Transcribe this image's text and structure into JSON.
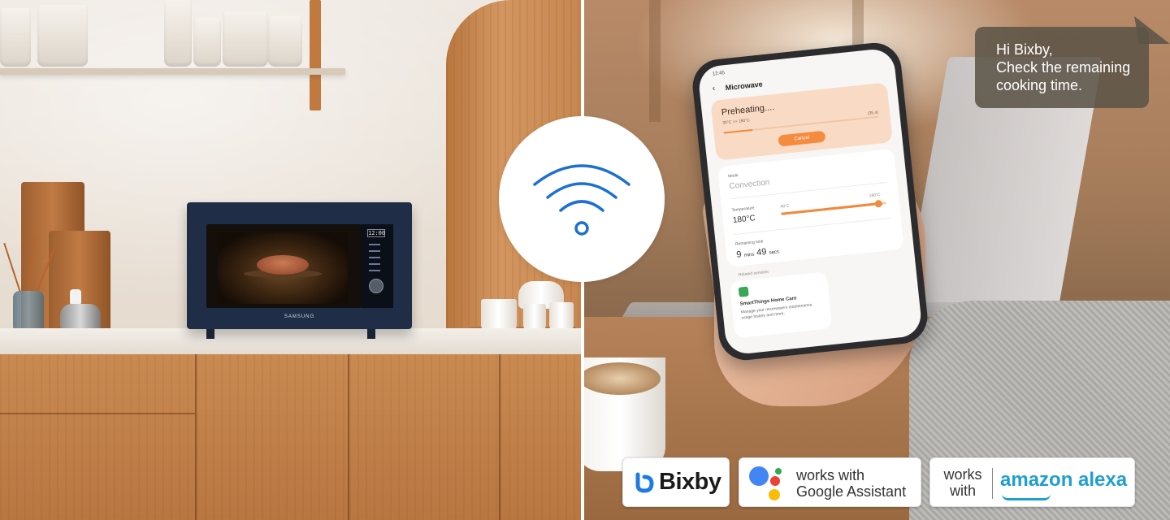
{
  "microwave": {
    "display": "12:00",
    "brand": "SAMSUNG"
  },
  "speech_bubble": {
    "text": "Hi Bixby,\nCheck the remaining\ncooking time."
  },
  "phone": {
    "status_time": "12:45",
    "back_icon": "back-arrow-icon",
    "app_title": "Microwave",
    "preheat": {
      "title": "Preheating....",
      "subtitle": "35°C >> 180°C",
      "percent_label": "(35.4)",
      "progress": 0.19,
      "cancel_label": "Cancel"
    },
    "mode": {
      "label": "Mode",
      "value": "Convection"
    },
    "temperature": {
      "label": "Temperature",
      "value": "180°C",
      "min_label": "40°C",
      "max_label": "180°C",
      "level": 0.92
    },
    "remaining": {
      "label": "Remaining time",
      "minutes": "9",
      "minutes_unit": "mins",
      "seconds": "49",
      "seconds_unit": "secs"
    },
    "related": {
      "label": "Related services",
      "service_title": "SmartThings Home Care",
      "service_desc": "Manage your microwave's maintenance, usage history and more."
    }
  },
  "badges": {
    "bixby": {
      "label": "Bixby",
      "icon": "bixby-icon"
    },
    "google": {
      "line1": "works with",
      "line2": "Google Assistant",
      "icon": "google-assistant-icon"
    },
    "alexa": {
      "works_line1": "works",
      "works_line2": "with",
      "logo": "amazon alexa"
    }
  },
  "wifi": {
    "icon": "wifi-icon"
  },
  "colors": {
    "accent_orange": "#f08a3c",
    "wifi_blue": "#1d6fd1",
    "alexa_blue": "#1f9ed1",
    "microwave_navy": "#1f2d47"
  }
}
